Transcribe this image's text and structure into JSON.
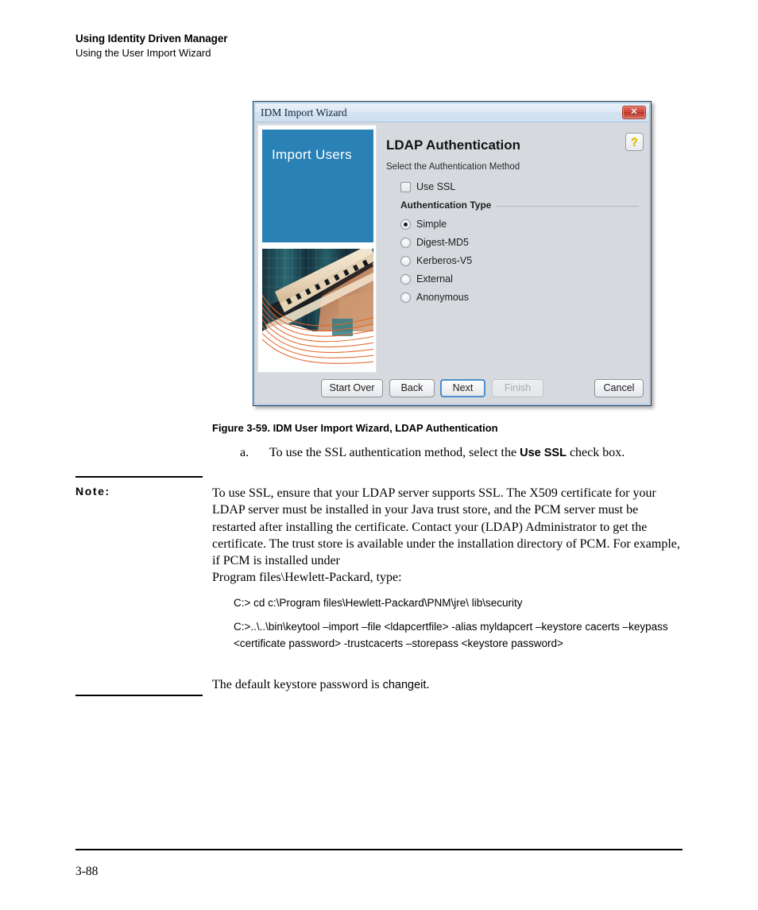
{
  "page_header": {
    "line1": "Using Identity Driven Manager",
    "line2": "Using the User Import Wizard"
  },
  "dialog": {
    "titlebar": {
      "title": "IDM Import Wizard",
      "close_label": "✕",
      "close_icon": "close-icon"
    },
    "banner": {
      "title": "Import Users",
      "blue_hex": "#2a81b6",
      "photo_alt": "building-and-bridge-photo"
    },
    "content": {
      "heading": "LDAP Authentication",
      "help_label": "?",
      "subtitle": "Select the Authentication Method",
      "checkbox": {
        "label": "Use SSL",
        "checked": false
      },
      "group_label": "Authentication Type",
      "radios": [
        {
          "label": "Simple",
          "checked": true
        },
        {
          "label": "Digest-MD5",
          "checked": false
        },
        {
          "label": "Kerberos-V5",
          "checked": false
        },
        {
          "label": "External",
          "checked": false
        },
        {
          "label": "Anonymous",
          "checked": false
        }
      ]
    },
    "buttons": {
      "start_over": "Start Over",
      "back": "Back",
      "next": "Next",
      "finish": "Finish",
      "cancel": "Cancel"
    }
  },
  "figure": {
    "caption": "Figure 3-59. IDM User Import Wizard, LDAP Authentication"
  },
  "step": {
    "marker": "a.",
    "text_before": "To use the SSL authentication method, select the ",
    "text_bold": "Use SSL",
    "text_after": " check box."
  },
  "note": {
    "label": "Note:",
    "paragraph": "To use SSL, ensure that your LDAP server supports SSL. The X509 certificate for your LDAP server must be installed in your Java trust store, and the PCM server must be restarted after installing the certificate. Contact your (LDAP) Administrator to get the certificate. The trust store is available under the installation directory of PCM. For example, if PCM is installed under",
    "paragraph_line2": "Program files\\Hewlett-Packard, type:",
    "command_1": "C:> cd c:\\Program files\\Hewlett-Packard\\PNM\\jre\\ lib\\security",
    "command_2": "C:>..\\..\\bin\\keytool –import –file <ldapcertfile> -alias myldapcert –keystore cacerts –keypass <certificate password> -trustcacerts –storepass <keystore password>",
    "footer_before": "The default keystore password is ",
    "footer_mono": "changeit",
    "footer_after": "."
  },
  "page_footer": {
    "page_number": "3-88"
  }
}
